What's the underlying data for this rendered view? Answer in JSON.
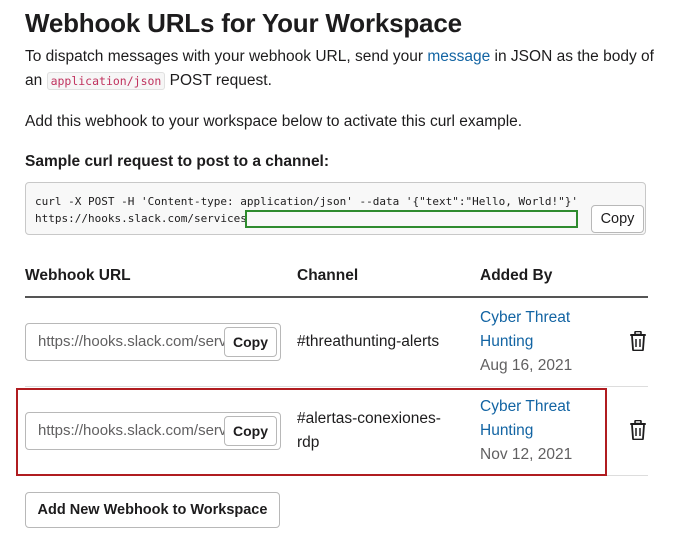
{
  "page": {
    "title": "Webhook URLs for Your Workspace",
    "intro_before_link": "To dispatch messages with your webhook URL, send your ",
    "intro_link": "message",
    "intro_after_link": " in JSON as the body of an ",
    "intro_code": "application/json",
    "intro_end": " POST request.",
    "activate_text": "Add this webhook to your workspace below to activate this curl example."
  },
  "curl": {
    "label": "Sample curl request to post to a channel:",
    "line1": "curl -X POST -H 'Content-type: application/json' --data '{\"text\":\"Hello, World!\"}'",
    "line2": "https://hooks.slack.com/services",
    "copy_label": "Copy"
  },
  "table": {
    "headers": {
      "url": "Webhook URL",
      "channel": "Channel",
      "added_by": "Added By"
    },
    "rows": [
      {
        "url": "https://hooks.slack.com/services/",
        "copy_label": "Copy",
        "channel_line1": "#threathunting-alerts",
        "channel_line2": "",
        "added_by_line1": "Cyber Threat",
        "added_by_line2": "Hunting",
        "date": "Aug 16, 2021",
        "delete_icon": "trash-icon"
      },
      {
        "url": "https://hooks.slack.com/services/",
        "copy_label": "Copy",
        "channel_line1": "#alertas-conexiones-",
        "channel_line2": "rdp",
        "added_by_line1": "Cyber Threat",
        "added_by_line2": "Hunting",
        "date": "Nov 12, 2021",
        "delete_icon": "trash-icon"
      }
    ]
  },
  "add_button_label": "Add New Webhook to Workspace",
  "colors": {
    "link": "#1264a3",
    "code": "#c0325e",
    "highlight_border": "#b01c20",
    "redaction_border": "#2e8b2e"
  }
}
